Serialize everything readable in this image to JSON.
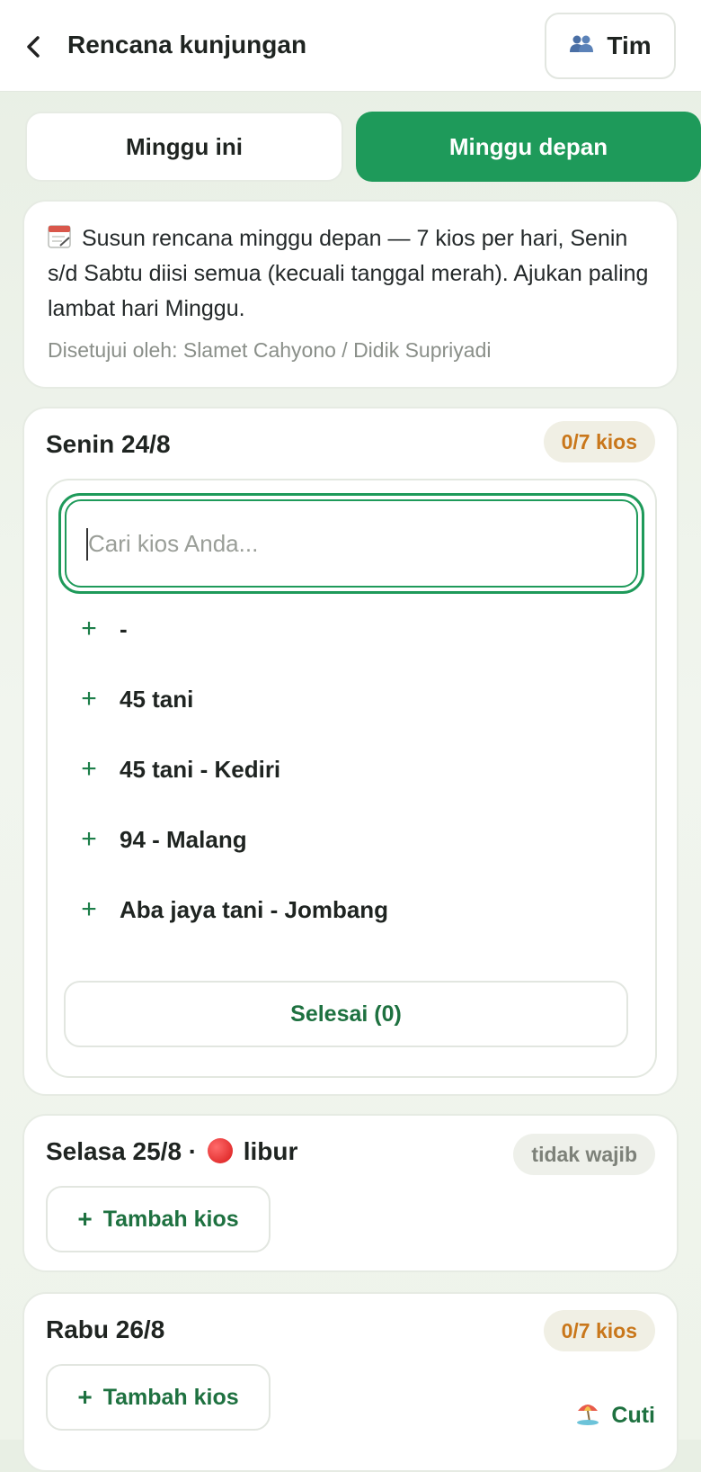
{
  "header": {
    "title": "Rencana kunjungan",
    "team_label": "Tim"
  },
  "tabs": [
    {
      "label": "Minggu ini",
      "active": false
    },
    {
      "label": "Minggu depan",
      "active": true
    }
  ],
  "info": {
    "text": "Susun rencana minggu depan — 7 kios per hari, Senin s/d Sabtu diisi semua (kecuali tanggal merah). Ajukan paling lambat hari Minggu.",
    "approver": "Disetujui oleh: Slamet Cahyono / Didik Supriyadi"
  },
  "days": {
    "monday": {
      "title": "Senin 24/8",
      "badge": "0/7 kios",
      "search_placeholder": "Cari kios Anda...",
      "kios": [
        "-",
        "45 tani",
        "45 tani - Kediri",
        "94 - Malang",
        "Aba jaya tani - Jombang"
      ],
      "done_label": "Selesai (0)"
    },
    "tuesday": {
      "title": "Selasa 25/8 ·",
      "holiday": "libur",
      "badge": "tidak wajib",
      "add_label": "Tambah kios"
    },
    "wednesday": {
      "title": "Rabu 26/8",
      "badge": "0/7 kios",
      "add_label": "Tambah kios",
      "leave_label": "Cuti"
    }
  },
  "colors": {
    "accent": "#1e9a5a",
    "badge_orange": "#c9771b",
    "text_green": "#1e7140"
  }
}
